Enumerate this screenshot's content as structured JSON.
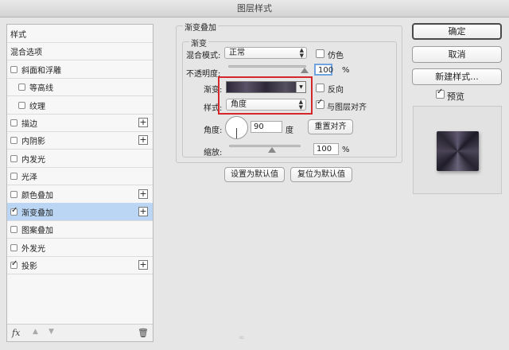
{
  "window": {
    "title": "图层样式"
  },
  "sidebar": {
    "items": [
      {
        "label": "样式",
        "checkbox": false,
        "checked": false,
        "plus": false,
        "selected": false,
        "indent": false
      },
      {
        "label": "混合选项",
        "checkbox": false,
        "checked": false,
        "plus": false,
        "selected": false,
        "indent": false
      },
      {
        "label": "斜面和浮雕",
        "checkbox": true,
        "checked": false,
        "plus": false,
        "selected": false,
        "indent": false
      },
      {
        "label": "等高线",
        "checkbox": true,
        "checked": false,
        "plus": false,
        "selected": false,
        "indent": true
      },
      {
        "label": "纹理",
        "checkbox": true,
        "checked": false,
        "plus": false,
        "selected": false,
        "indent": true
      },
      {
        "label": "描边",
        "checkbox": true,
        "checked": false,
        "plus": true,
        "selected": false,
        "indent": false
      },
      {
        "label": "内阴影",
        "checkbox": true,
        "checked": false,
        "plus": true,
        "selected": false,
        "indent": false
      },
      {
        "label": "内发光",
        "checkbox": true,
        "checked": false,
        "plus": false,
        "selected": false,
        "indent": false
      },
      {
        "label": "光泽",
        "checkbox": true,
        "checked": false,
        "plus": false,
        "selected": false,
        "indent": false
      },
      {
        "label": "颜色叠加",
        "checkbox": true,
        "checked": false,
        "plus": true,
        "selected": false,
        "indent": false
      },
      {
        "label": "渐变叠加",
        "checkbox": true,
        "checked": true,
        "plus": true,
        "selected": true,
        "indent": false
      },
      {
        "label": "图案叠加",
        "checkbox": true,
        "checked": false,
        "plus": false,
        "selected": false,
        "indent": false
      },
      {
        "label": "外发光",
        "checkbox": true,
        "checked": false,
        "plus": false,
        "selected": false,
        "indent": false
      },
      {
        "label": "投影",
        "checkbox": true,
        "checked": true,
        "plus": true,
        "selected": false,
        "indent": false
      }
    ],
    "footer": {
      "fx_label": "fx",
      "up": "▲",
      "down": "▼",
      "trash": "🗑"
    }
  },
  "panel": {
    "group_title": "渐变叠加",
    "subgroup_title": "渐变",
    "blend_mode_label": "混合模式:",
    "blend_mode_value": "正常",
    "dither_label": "仿色",
    "opacity_label": "不透明度:",
    "opacity_value": "100",
    "opacity_pct": 1.0,
    "gradient_label": "渐变:",
    "reverse_label": "反向",
    "style_label": "样式:",
    "style_value": "角度",
    "align_label": "与图层对齐",
    "align_checked": true,
    "angle_label": "角度:",
    "angle_value": "90",
    "angle_unit": "度",
    "reset_align_button": "重置对齐",
    "scale_label": "缩放:",
    "scale_value": "100",
    "scale_pct": 1.0,
    "percent_sign": "%",
    "set_default_button": "设置为默认值",
    "reset_default_button": "复位为默认值"
  },
  "actions": {
    "ok": "确定",
    "cancel": "取消",
    "new_style": "新建样式...",
    "preview_label": "预览",
    "preview_checked": true
  },
  "colors": {
    "highlight": "#d4262b",
    "selection": "#bad6f4"
  },
  "watermark": "∞"
}
